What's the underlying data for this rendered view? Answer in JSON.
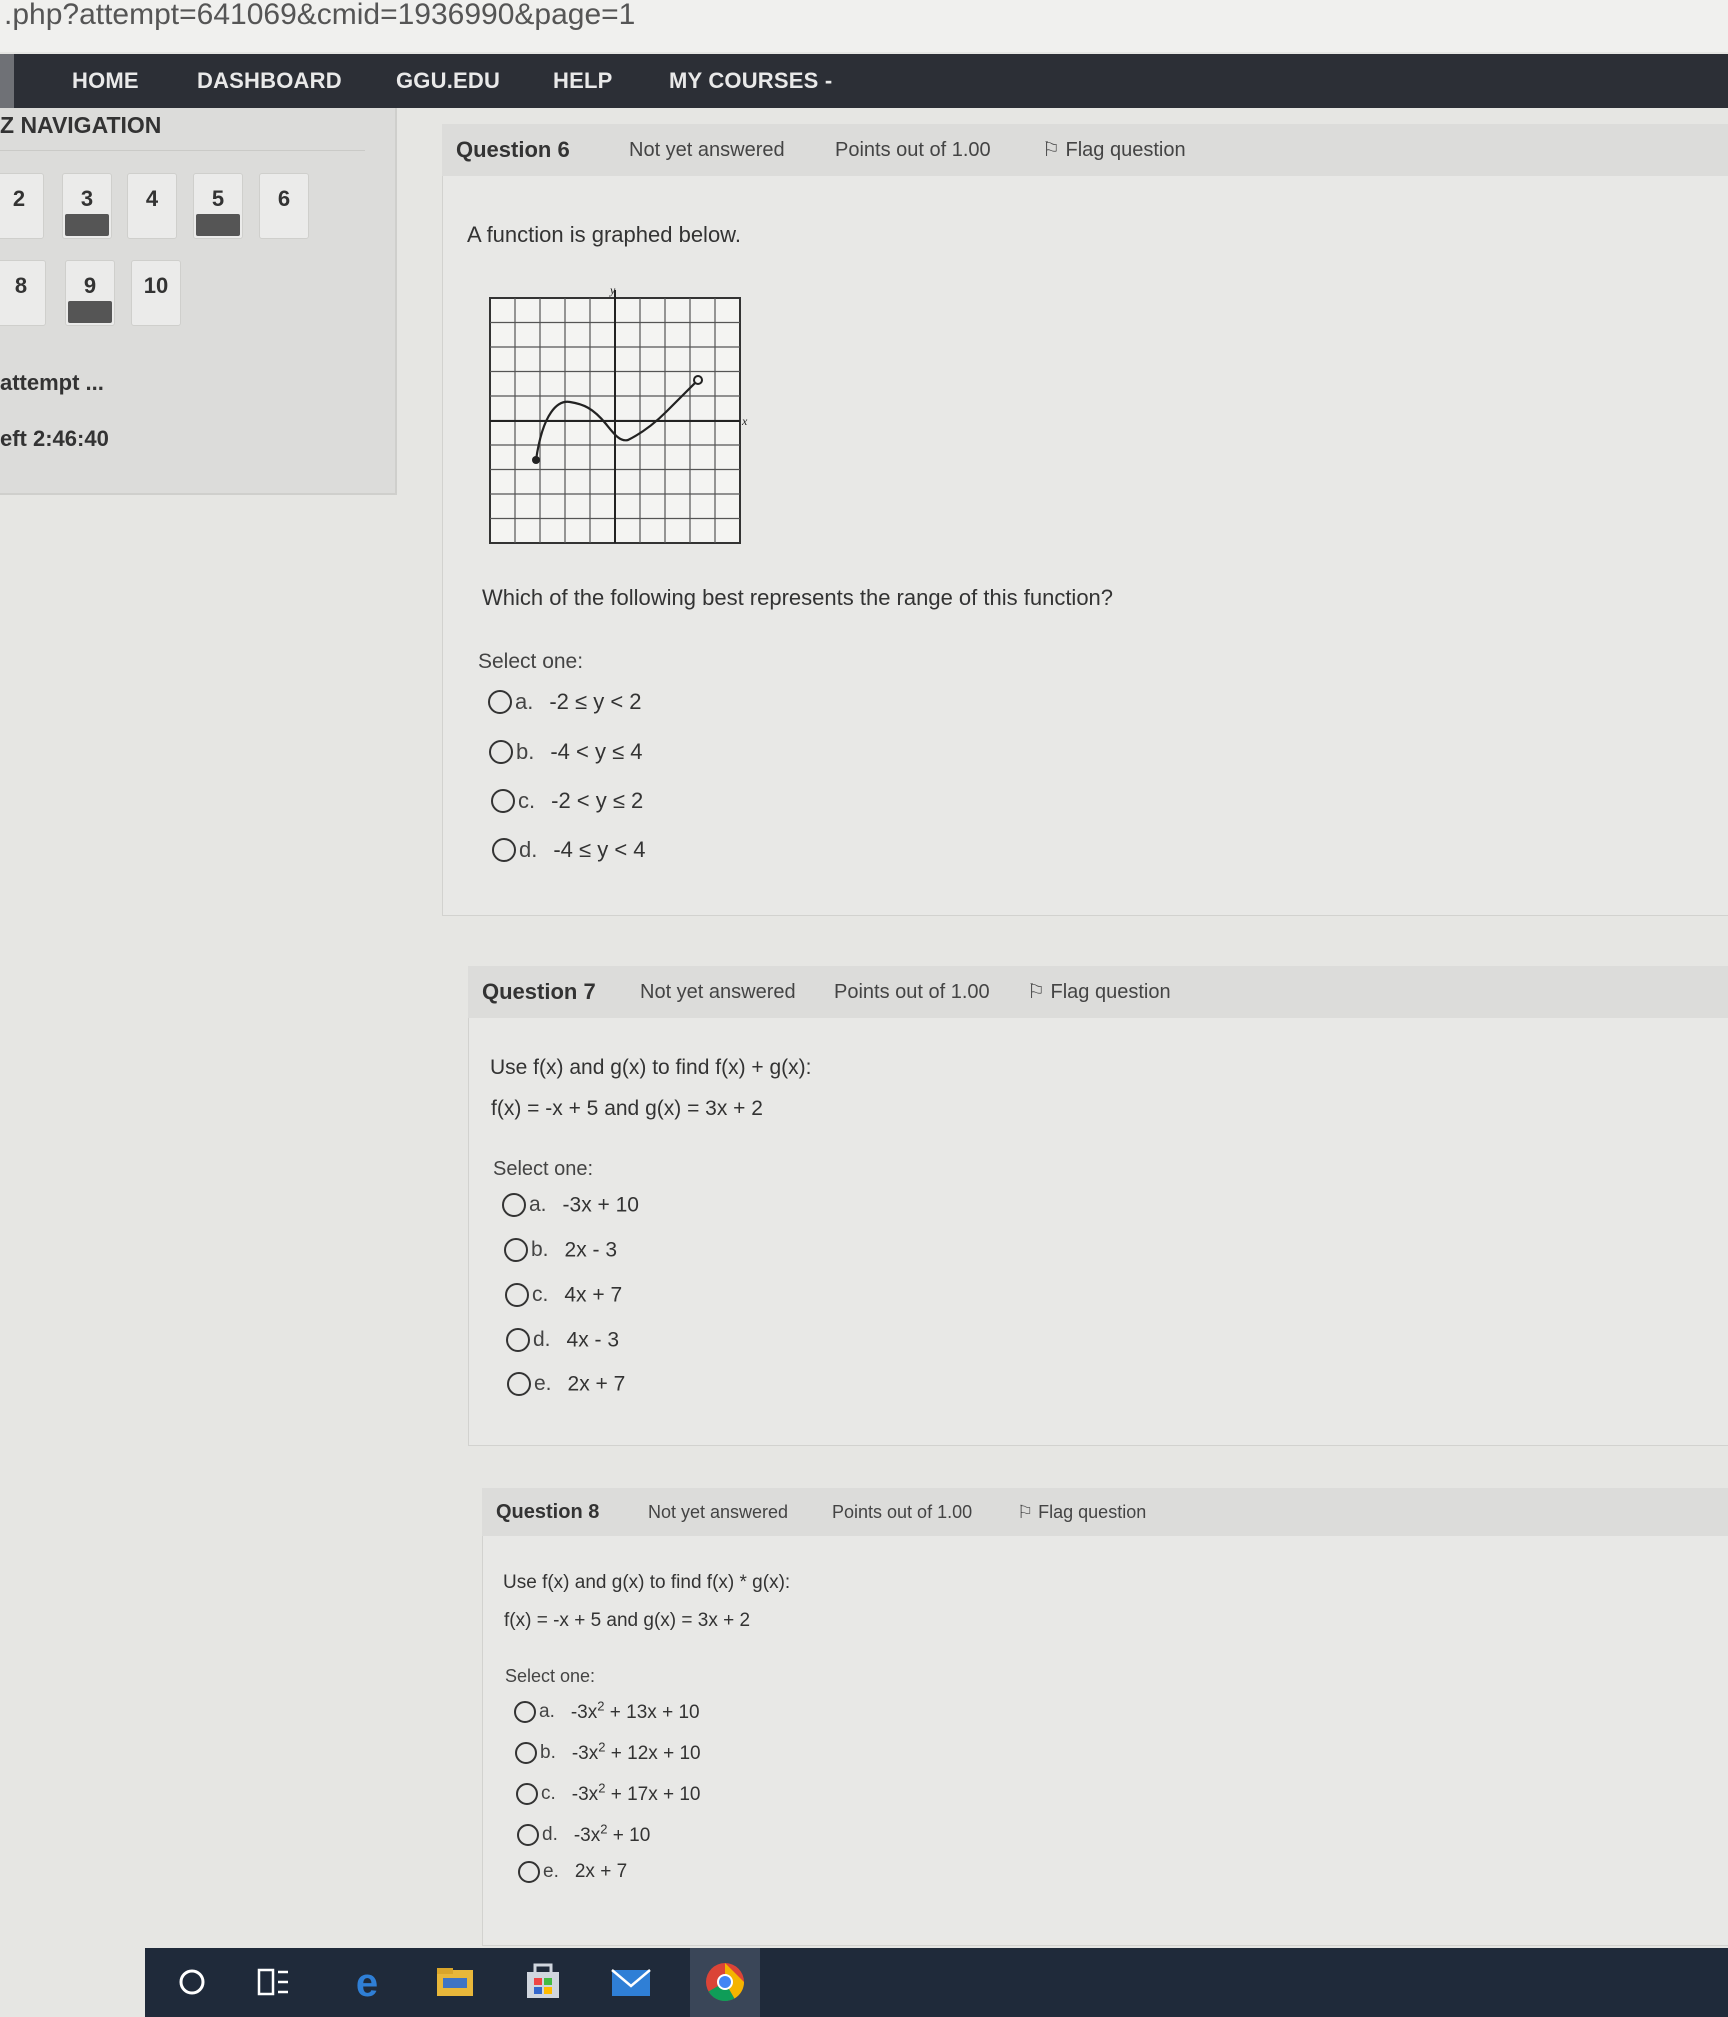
{
  "browser": {
    "url": ".php?attempt=641069&cmid=1936990&page=1"
  },
  "nav": {
    "home": "HOME",
    "dashboard": "DASHBOARD",
    "ggu": "GGU.EDU",
    "help": "HELP",
    "mycourses": "MY COURSES -"
  },
  "sidebar": {
    "title": "Z NAVIGATION",
    "row1": [
      "2",
      "3",
      "4",
      "5",
      "6"
    ],
    "row2": [
      "8",
      "9",
      "10"
    ],
    "attempt": "attempt ...",
    "timer": "eft 2:46:40"
  },
  "q6": {
    "number": "Question 6",
    "state": "Not yet answered",
    "points": "Points out of 1.00",
    "flag": "Flag question",
    "intro": "A function is graphed below.",
    "graph_axis_x": "x",
    "graph_axis_y": "y",
    "prompt": "Which of the following best represents the range of this function?",
    "select": "Select one:",
    "options": [
      {
        "letter": "a.",
        "text": "-2 ≤ y < 2"
      },
      {
        "letter": "b.",
        "text": "-4 < y ≤ 4"
      },
      {
        "letter": "c.",
        "text": "-2 < y ≤ 2"
      },
      {
        "letter": "d.",
        "text": "-4 ≤ y < 4"
      }
    ]
  },
  "q7": {
    "number": "Question 7",
    "state": "Not yet answered",
    "points": "Points out of 1.00",
    "flag": "Flag question",
    "line1": "Use f(x) and g(x) to find f(x) + g(x):",
    "line2": "f(x) = -x + 5 and g(x) = 3x + 2",
    "select": "Select one:",
    "options": [
      {
        "letter": "a.",
        "text": "-3x + 10"
      },
      {
        "letter": "b.",
        "text": "2x - 3"
      },
      {
        "letter": "c.",
        "text": "4x + 7"
      },
      {
        "letter": "d.",
        "text": "4x - 3"
      },
      {
        "letter": "e.",
        "text": "2x + 7"
      }
    ]
  },
  "q8": {
    "number": "Question 8",
    "state": "Not yet answered",
    "points": "Points out of 1.00",
    "flag": "Flag question",
    "line1": "Use f(x) and g(x) to find f(x) * g(x):",
    "line2": "f(x) = -x + 5 and g(x) = 3x + 2",
    "select": "Select one:",
    "options": [
      {
        "letter": "a.",
        "pre": "-3x",
        "sup": "2",
        "post": " + 13x + 10"
      },
      {
        "letter": "b.",
        "pre": "-3x",
        "sup": "2",
        "post": " + 12x + 10"
      },
      {
        "letter": "c.",
        "pre": "-3x",
        "sup": "2",
        "post": " + 17x + 10"
      },
      {
        "letter": "d.",
        "pre": "-3x",
        "sup": "2",
        "post": " + 10"
      },
      {
        "letter": "e.",
        "pre": "2x + 7",
        "sup": "",
        "post": ""
      }
    ]
  },
  "taskbar": {
    "icons": [
      "cortana-icon",
      "task-view-icon",
      "edge-icon",
      "file-explorer-icon",
      "store-icon",
      "mail-icon",
      "chrome-icon"
    ]
  }
}
